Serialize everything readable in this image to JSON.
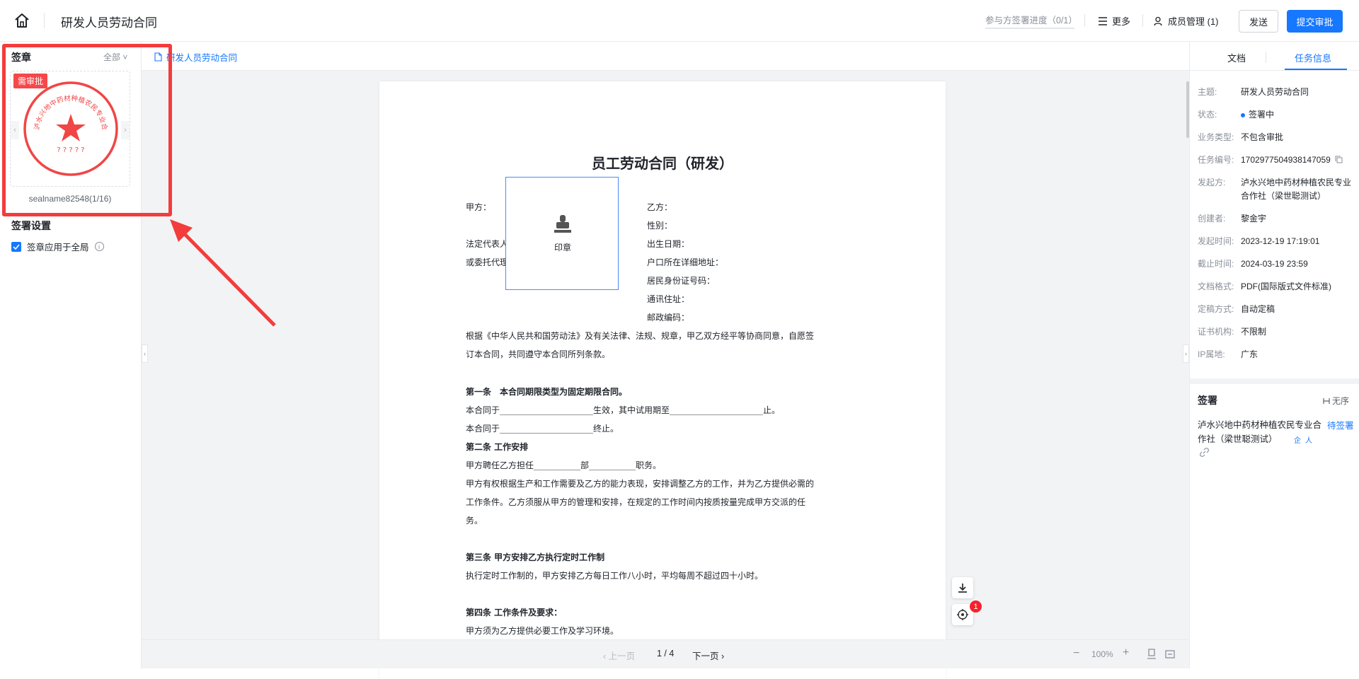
{
  "header": {
    "title": "研发人员劳动合同",
    "progress": "参与方签署进度（0/1）",
    "more": "更多",
    "members": "成员管理 (1)",
    "send": "发送",
    "submit": "提交审批"
  },
  "left": {
    "seal_section": "签章",
    "seal_filter": "全部 ˅",
    "seal_tag": "需审批",
    "seal_name": "sealname82548(1/16)",
    "seal_ring_text": "泸水兴地中药材种植农民专业合作社（梁世聪测试）",
    "seal_code": "? ? ? ? ?",
    "settings_title": "签署设置",
    "apply_all": "签章应用于全局",
    "accent": "#f33c3c"
  },
  "center": {
    "file_tab": "研发人员劳动合同",
    "stamp_label": "印章",
    "contract": {
      "title": "员工劳动合同（研发）",
      "party_a": "甲方：",
      "legal_rep": "法定代表人",
      "agent": "或委托代理人",
      "party_b": "乙方：",
      "gender": "性别：",
      "birth": "出生日期：",
      "hukou": "户口所在详细地址：",
      "id_no": "居民身份证号码：",
      "address": "通讯住址：",
      "postcode": "邮政编码：",
      "intro1": "根据《中华人民共和国劳动法》及有关法律、法规、规章，甲乙双方经平等协商同意，自愿签",
      "intro2": "订本合同，共同遵守本合同所列条款。",
      "a1_title": "第一条　本合同期限类型为固定期限合同。",
      "a1_l1": "本合同于______________________生效，其中试用期至______________________止。",
      "a1_l2": "本合同于______________________终止。",
      "a2_title": "第二条 工作安排",
      "a2_l1": "甲方聘任乙方担任___________部___________职务。",
      "a2_l2": "甲方有权根据生产和工作需要及乙方的能力表现，安排调整乙方的工作，并为乙方提供必需的",
      "a2_l3": "工作条件。乙方须服从甲方的管理和安排，在规定的工作时间内按质按量完成甲方交派的任",
      "a2_l4": "务。",
      "a3_title": "第三条 甲方安排乙方执行定时工作制",
      "a3_l1": "执行定时工作制的，甲方安排乙方每日工作八小时，平均每周不超过四十小时。",
      "a4_title": "第四条 工作条件及要求：",
      "a4_l1": "甲方须为乙方提供必要工作及学习环境。"
    },
    "badge_count": "1",
    "pager": {
      "prev": "上一页",
      "page": "1 / 4",
      "next": "下一页",
      "zoom": "100%"
    }
  },
  "right": {
    "tab_doc": "文档",
    "tab_info": "任务信息",
    "info": [
      {
        "key": "主题:",
        "value": "研发人员劳动合同"
      },
      {
        "key": "状态:",
        "value": "签署中"
      },
      {
        "key": "业务类型:",
        "value": "不包含审批"
      },
      {
        "key": "任务编号:",
        "value": "1702977504938147059"
      },
      {
        "key": "发起方:",
        "value": "泸水兴地中药材种植农民专业合作社（梁世聪测试）"
      },
      {
        "key": "创建者:",
        "value": "黎金宇"
      },
      {
        "key": "发起时间:",
        "value": "2023-12-19 17:19:01"
      },
      {
        "key": "截止时间:",
        "value": "2024-03-19 23:59"
      },
      {
        "key": "文档格式:",
        "value": "PDF(国际版式文件标准)"
      },
      {
        "key": "定稿方式:",
        "value": "自动定稿"
      },
      {
        "key": "证书机构:",
        "value": "不限制"
      },
      {
        "key": "IP属地:",
        "value": "广东"
      }
    ],
    "sign_title": "签署",
    "sign_order": "无序",
    "signer": "泸水兴地中药材种植农民专业合作社（梁世聪测试）",
    "signer_status": "待签署",
    "tag_ent": "企",
    "tag_person": "人"
  }
}
